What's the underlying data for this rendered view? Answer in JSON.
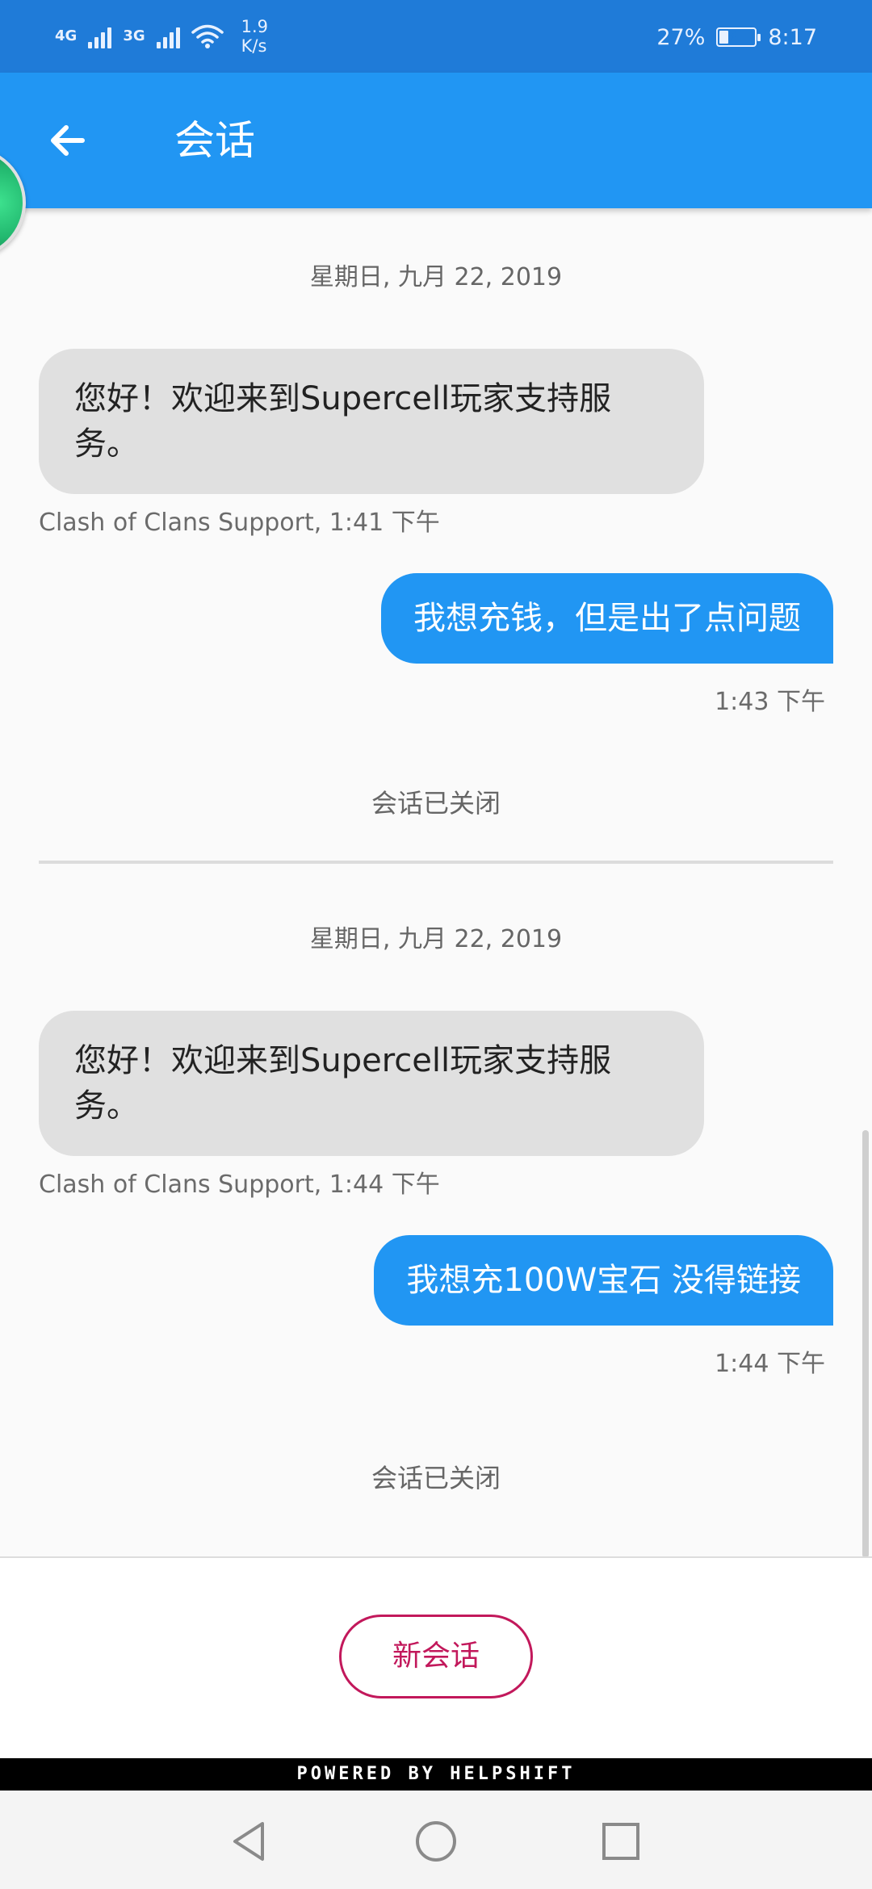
{
  "status_bar": {
    "network_1": "4G",
    "network_2": "3G",
    "speed_value": "1.9",
    "speed_unit": "K/s",
    "battery_percent": "27%",
    "battery_level": 0.27,
    "time": "8:17",
    "icons": [
      "signal-icon",
      "wifi-icon",
      "battery-icon"
    ]
  },
  "app_bar": {
    "title": "会话",
    "back_icon": "arrow-left-icon"
  },
  "conversations": [
    {
      "date": "星期日, 九月 22, 2019",
      "incoming_text": "您好！欢迎来到Supercell玩家支持服务。",
      "incoming_meta": "Clash of Clans Support, 1:41 下午",
      "outgoing_text": "我想充钱，但是出了点问题",
      "outgoing_time": "1:43 下午",
      "closed_label": "会话已关闭"
    },
    {
      "date": "星期日, 九月 22, 2019",
      "incoming_text": "您好！欢迎来到Supercell玩家支持服务。",
      "incoming_meta": "Clash of Clans Support, 1:44 下午",
      "outgoing_text": "我想充100W宝石 没得链接",
      "outgoing_time": "1:44 下午",
      "closed_label": "会话已关闭"
    }
  ],
  "new_conversation_label": "新会话",
  "powered_by": "POWERED BY HELPSHIFT",
  "nav_bar": {
    "icons": [
      "back-triangle-icon",
      "home-circle-icon",
      "recents-square-icon"
    ]
  },
  "colors": {
    "status_bar": "#1f7bd8",
    "app_bar": "#2196f3",
    "outgoing_bubble": "#2196f3",
    "incoming_bubble": "#e0e0e0",
    "accent_pink": "#c2185b"
  }
}
